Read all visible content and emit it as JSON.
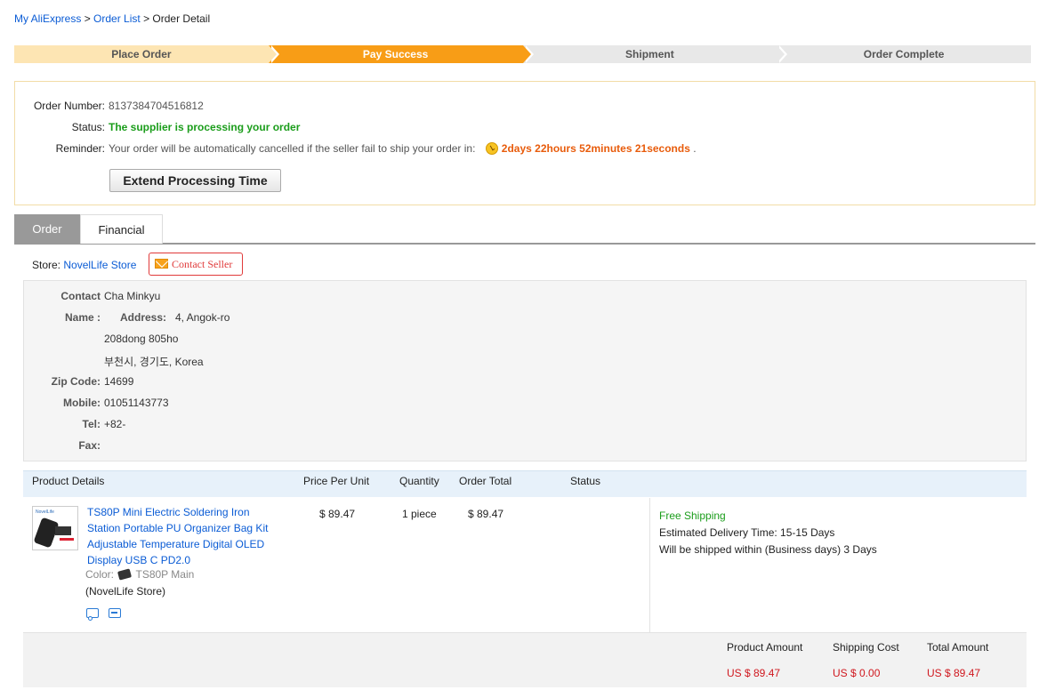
{
  "breadcrumb": {
    "link1": "My AliExpress",
    "sep1": " > ",
    "link2": "Order List",
    "sep2": " > ",
    "current": "Order Detail"
  },
  "steps": [
    "Place Order",
    "Pay Success",
    "Shipment",
    "Order Complete"
  ],
  "order_info": {
    "number_label": "Order Number:",
    "number": "8137384704516812",
    "status_label": "Status:",
    "status": "The supplier is processing your order",
    "reminder_label": "Reminder:",
    "reminder_text": "Your order will be automatically cancelled if the seller fail to ship your order in:",
    "countdown": "2days 22hours 52minutes 21seconds",
    "reminder_end": ".",
    "extend_button": "Extend Processing Time"
  },
  "tabs": [
    "Order",
    "Financial"
  ],
  "store": {
    "label": "Store:",
    "name": "NovelLife Store",
    "contact_button": "Contact Seller"
  },
  "address": {
    "contact_label": "Contact",
    "name_label": "Name :",
    "contact_name": "Cha Minkyu",
    "address_label": "Address:",
    "address_line1": "4, Angok-ro",
    "address_line2": "208dong 805ho",
    "address_line3": "부천시, 경기도, Korea",
    "zip_label": "Zip Code:",
    "zip": "14699",
    "mobile_label": "Mobile:",
    "mobile": "01051143773",
    "tel_label": "Tel:",
    "tel": "+82-",
    "fax_label": "Fax:",
    "fax": ""
  },
  "product_table": {
    "headers": [
      "Product Details",
      "Price Per Unit",
      "Quantity",
      "Order Total",
      "Status"
    ],
    "item": {
      "thumb_brand": "NovelLife",
      "title": "TS80P Mini Electric Soldering Iron Station Portable PU Organizer Bag Kit Adjustable Temperature Digital OLED Display USB C PD2.0",
      "color_label": "Color:",
      "color_value": "TS80P Main",
      "store": "(NovelLife Store)",
      "price": "$ 89.47",
      "quantity": "1 piece",
      "total": "$ 89.47",
      "shipping": "Free Shipping",
      "delivery_label": "Estimated Delivery Time:",
      "delivery_value": "15-15 Days",
      "ship_within": "Will be shipped within (Business days) 3 Days"
    }
  },
  "summary": {
    "product_amount_label": "Product Amount",
    "product_amount": "US $ 89.47",
    "shipping_cost_label": "Shipping Cost",
    "shipping_cost": "US $ 0.00",
    "total_amount_label": "Total Amount",
    "total_amount": "US $ 89.47"
  }
}
